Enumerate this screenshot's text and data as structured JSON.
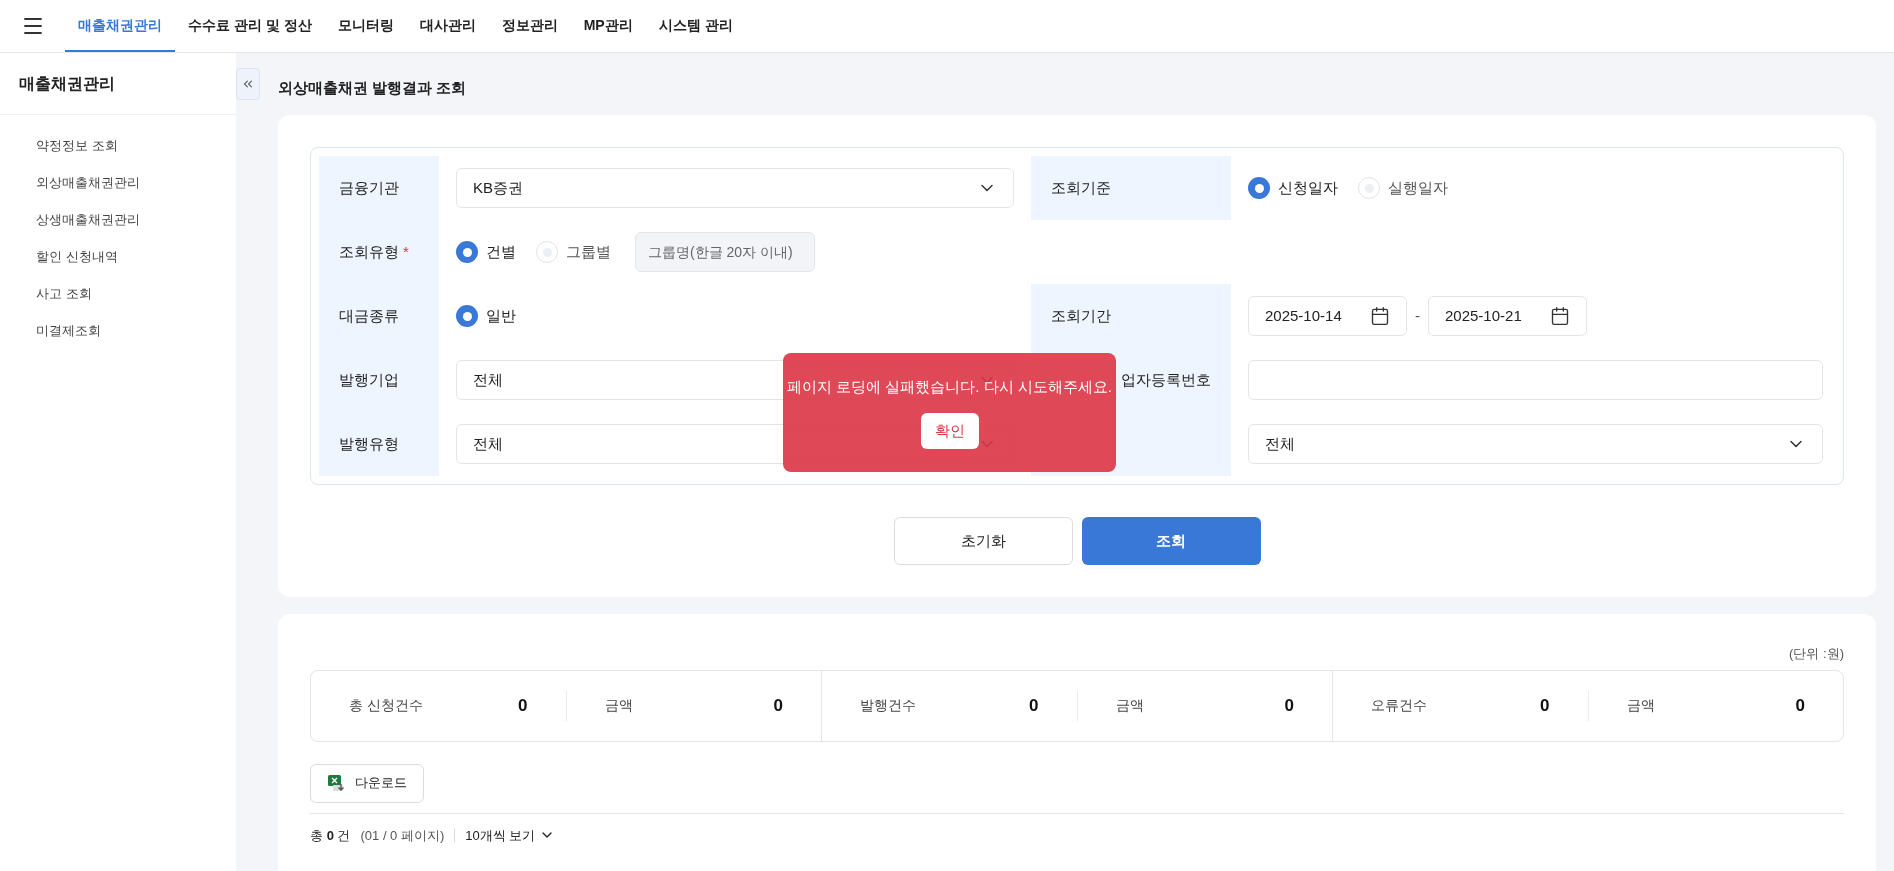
{
  "nav": {
    "items": [
      {
        "label": "매출채권관리",
        "selected": true
      },
      {
        "label": "수수료 관리 및 정산",
        "selected": false
      },
      {
        "label": "모니터링",
        "selected": false
      },
      {
        "label": "대사관리",
        "selected": false
      },
      {
        "label": "정보관리",
        "selected": false
      },
      {
        "label": "MP관리",
        "selected": false
      },
      {
        "label": "시스템 관리",
        "selected": false
      }
    ]
  },
  "sidebar": {
    "title": "매출채권관리",
    "items": [
      {
        "label": "약정정보 조회"
      },
      {
        "label": "외상매출채권관리"
      },
      {
        "label": "상생매출채권관리"
      },
      {
        "label": "할인 신청내역"
      },
      {
        "label": "사고 조회"
      },
      {
        "label": "미결제조회"
      }
    ]
  },
  "page_title": "외상매출채권 발행결과 조회",
  "search_form": {
    "rows": [
      {
        "cells": [
          {
            "label": "금융기관",
            "kind": "select",
            "value": "KB증권"
          },
          {
            "label": "조회기준",
            "kind": "radio",
            "options": [
              {
                "label": "신청일자",
                "selected": true
              },
              {
                "label": "실행일자",
                "selected": false
              }
            ]
          }
        ]
      },
      {
        "cells": [
          {
            "label": "조회유형",
            "required_mark": "*",
            "kind": "radio",
            "options": [
              {
                "label": "건별",
                "selected": true
              },
              {
                "label": "그룹별",
                "selected": false
              }
            ],
            "extra_field": {
              "placeholder": "그룹명(한글 20자 이내)"
            }
          }
        ]
      },
      {
        "cells": [
          {
            "label": "대금종류",
            "kind": "radio",
            "options": [
              {
                "label": "일반",
                "selected": true
              }
            ]
          },
          {
            "label": "조회기간",
            "kind": "date_range",
            "from": "2025-10-14",
            "separator": "-",
            "to": "2025-10-21"
          }
        ]
      },
      {
        "cells": [
          {
            "label": "발행기업",
            "kind": "select",
            "value": "전체"
          },
          {
            "label": "업자등록번호",
            "label_covered": true,
            "kind": "text"
          }
        ]
      },
      {
        "cells": [
          {
            "label": "발행유형",
            "kind": "select",
            "value": "전체"
          },
          {
            "kind": "select",
            "value": "전체"
          }
        ]
      }
    ],
    "buttons": [
      {
        "label": "초기화",
        "kind": "secondary"
      },
      {
        "label": "조회",
        "kind": "primary"
      }
    ]
  },
  "summary": {
    "unit": "(단위 :원)",
    "groups": [
      {
        "items": [
          {
            "label": "총 신청건수",
            "value": "0"
          },
          {
            "label": "금액",
            "value": "0"
          }
        ]
      },
      {
        "items": [
          {
            "label": "발행건수",
            "value": "0"
          },
          {
            "label": "금액",
            "value": "0"
          }
        ]
      },
      {
        "items": [
          {
            "label": "오류건수",
            "value": "0"
          },
          {
            "label": "금액",
            "value": "0"
          }
        ]
      }
    ]
  },
  "download_button": "다운로드",
  "pagination": {
    "total": "총 **0** 건",
    "pages": "(01 / 0 페이지)",
    "page_size": "10개씩 보기"
  },
  "toast": {
    "message": "페이지 로딩에 실패했습니다. 다시 시도해주세요.",
    "button": "확인"
  }
}
